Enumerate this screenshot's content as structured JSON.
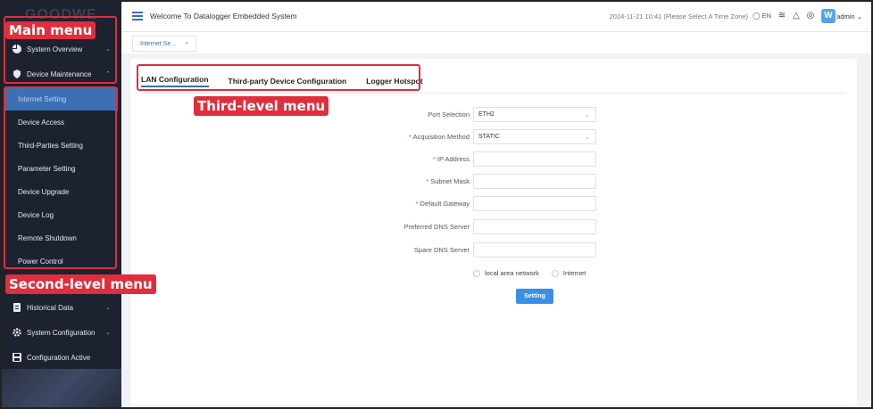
{
  "sidebar": {
    "logo": "GOODWE",
    "main_items_top": [
      {
        "label": "System Overview",
        "icon": "pie-chart-icon"
      },
      {
        "label": "Device Maintenance",
        "icon": "shield-icon"
      }
    ],
    "sub_items": [
      {
        "label": "Internet Setting",
        "active": true
      },
      {
        "label": "Device Access"
      },
      {
        "label": "Third-Parties Setting"
      },
      {
        "label": "Parameter Setting"
      },
      {
        "label": "Device Upgrade"
      },
      {
        "label": "Device Log"
      },
      {
        "label": "Remote Shutdown"
      },
      {
        "label": "Power Control"
      }
    ],
    "main_items_bottom": [
      {
        "label": "Historical Data",
        "icon": "document-icon"
      },
      {
        "label": "System Configuration",
        "icon": "gear-icon"
      },
      {
        "label": "Configuration Active",
        "icon": "save-icon"
      }
    ]
  },
  "header": {
    "welcome": "Welcome To Datalogger Embedded System",
    "timestamp": "2024-11-21 10:41 (Please Select A Time Zone)",
    "language": "EN",
    "user": "admin"
  },
  "tabs": {
    "page_tab": "Internet Se..."
  },
  "panel": {
    "subtabs": [
      "LAN Configuration",
      "Third-party Device Configuration",
      "Logger Hotspot"
    ],
    "form": [
      {
        "label": "Port Selection",
        "required": false,
        "value": "ETH2",
        "type": "select"
      },
      {
        "label": "Acquisition Method",
        "required": true,
        "value": "STATIC",
        "type": "select"
      },
      {
        "label": "IP Address",
        "required": true,
        "value": "",
        "type": "input"
      },
      {
        "label": "Subnet Mask",
        "required": true,
        "value": "",
        "type": "input"
      },
      {
        "label": "Default Gateway",
        "required": true,
        "value": "",
        "type": "input"
      },
      {
        "label": "Preferred DNS Server",
        "required": false,
        "value": "",
        "type": "input"
      },
      {
        "label": "Spare DNS Server",
        "required": false,
        "value": "",
        "type": "input"
      }
    ],
    "radios": [
      "local area network",
      "Internet"
    ],
    "button": "Setting"
  },
  "annotations": {
    "main_menu": "Main menu",
    "second_level": "Second-level menu",
    "third_level": "Third-level menu"
  },
  "colors": {
    "accent": "#3c6fb4",
    "button": "#3a8ee6",
    "annotation": "#e02e3c",
    "sidebar_bg": "#1d2230"
  }
}
